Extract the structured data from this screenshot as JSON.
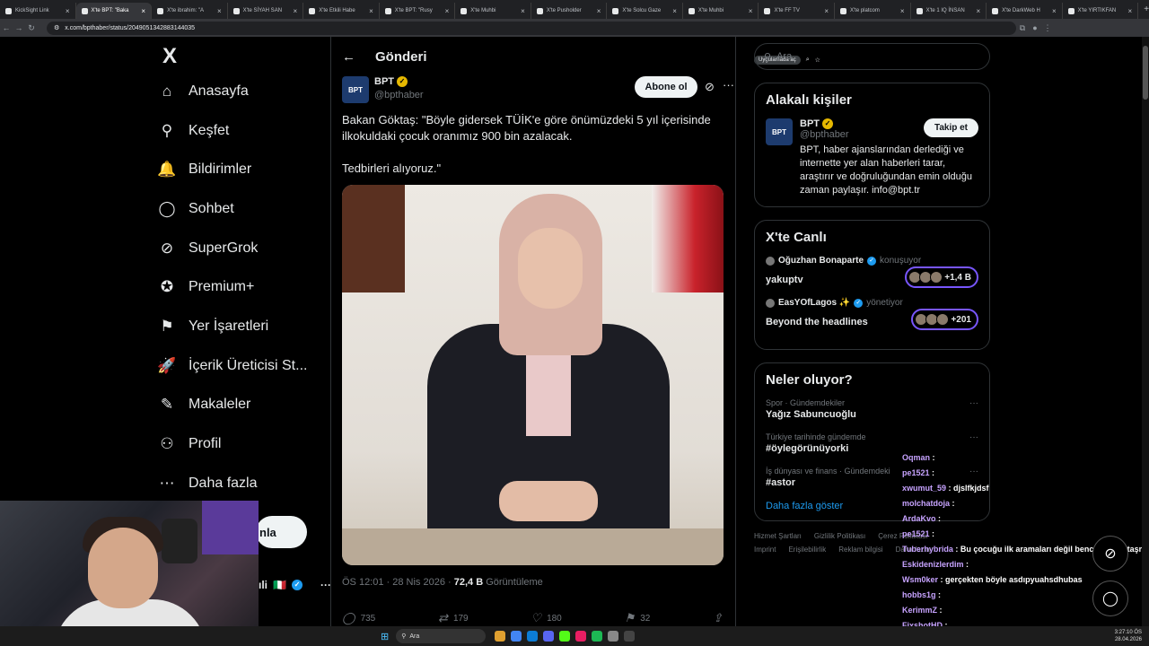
{
  "browser": {
    "tabs": [
      {
        "label": "KickSight Link"
      },
      {
        "label": "X'te BPT: \"Baka",
        "active": true
      },
      {
        "label": "X'te ibrahim: \"A"
      },
      {
        "label": "X'te SİYAH SAN"
      },
      {
        "label": "X'te Etkili Habe"
      },
      {
        "label": "X'te BPT: \"Rusy"
      },
      {
        "label": "X'te Muhbi"
      },
      {
        "label": "X'te Pusholder"
      },
      {
        "label": "X'te Solcu Gaze"
      },
      {
        "label": "X'te Muhbi"
      },
      {
        "label": "X'te FF TV"
      },
      {
        "label": "X'te platcom"
      },
      {
        "label": "X'te 1 IQ İNSAN"
      },
      {
        "label": "X'te DarkWeb H"
      },
      {
        "label": "X'te YIRTIKFAN"
      }
    ],
    "url": "x.com/bpthaber/status/2049051342883144035",
    "open_in_app": "Uygulamada aç"
  },
  "nav": {
    "logo": "X",
    "items": [
      {
        "label": "Anasayfa",
        "icon": "home-icon",
        "glyph": "⌂"
      },
      {
        "label": "Keşfet",
        "icon": "search-icon",
        "glyph": "⚲"
      },
      {
        "label": "Bildirimler",
        "icon": "bell-icon",
        "glyph": "🔔"
      },
      {
        "label": "Sohbet",
        "icon": "chat-icon",
        "glyph": "◯"
      },
      {
        "label": "SuperGrok",
        "icon": "grok-icon",
        "glyph": "⊘"
      },
      {
        "label": "Premium+",
        "icon": "premium-icon",
        "glyph": "✪"
      },
      {
        "label": "Yer İşaretleri",
        "icon": "bookmark-icon",
        "glyph": "⚑"
      },
      {
        "label": "İçerik Üreticisi St...",
        "icon": "rocket-icon",
        "glyph": "🚀"
      },
      {
        "label": "Makaleler",
        "icon": "article-icon",
        "glyph": "✎"
      },
      {
        "label": "Profil",
        "icon": "profile-icon",
        "glyph": "⚇"
      },
      {
        "label": "Daha fazla",
        "icon": "more-icon",
        "glyph": "⋯"
      }
    ],
    "post_button": "nla",
    "account_name": "ıli"
  },
  "post": {
    "header": "Gönderi",
    "author_name": "BPT",
    "author_handle": "@bpthaber",
    "avatar_text": "BPT",
    "subscribe": "Abone ol",
    "text_line1": "Bakan Göktaş: \"Böyle gidersek TÜİK'e göre önümüzdeki 5 yıl içerisinde ilkokuldaki çocuk oranımız 900 bin azalacak.",
    "text_line2": "Tedbirleri alıyoruz.\"",
    "time": "ÖS 12:01 · 28 Nis 2026 · ",
    "views": "72,4 B",
    "views_label": " Görüntüleme",
    "replies": "735",
    "reposts": "179",
    "likes": "180",
    "bookmarks": "32"
  },
  "sidebar": {
    "search_placeholder": "Ara",
    "related_title": "Alakalı kişiler",
    "related": {
      "name": "BPT",
      "handle": "@bpthaber",
      "follow": "Takip et",
      "bio": "BPT, haber ajanslarından derlediği ve internette yer alan haberleri tarar, araştırır ve doğruluğundan emin olduğu zaman paylaşır. info@bpt.tr"
    },
    "live_title": "X'te Canlı",
    "live": [
      {
        "host": "Oğuzhan Bonaparte",
        "role": "konuşuyor",
        "title": "yakuptv",
        "count": "+1,4 B"
      },
      {
        "host": "EasYOfLagos ✨",
        "role": "yönetiyor",
        "title": "Beyond the headlines",
        "count": "+201"
      }
    ],
    "trends_title": "Neler oluyor?",
    "trends": [
      {
        "category": "Spor · Gündemdekiler",
        "title": "Yağız Sabuncuoğlu"
      },
      {
        "category": "Türkiye tarihinde gündemde",
        "title": "#öylegörünüyorki"
      },
      {
        "category": "İş dünyası ve finans · Gündemdeki",
        "title": "#astor"
      }
    ],
    "show_more": "Daha fazla göster",
    "footer": [
      "Hizmet Şartları",
      "Gizlilik Politikası",
      "Çerez Politikası",
      "Imprint",
      "Erişilebilirlik",
      "Reklam bilgisi",
      "Daha fazla"
    ]
  },
  "chat": [
    {
      "user": "Oqman",
      "msg": ""
    },
    {
      "user": "pe1521",
      "msg": ""
    },
    {
      "user": "xwumut_59",
      "msg": "djslfkjdsf"
    },
    {
      "user": "molchatdoja",
      "msg": ""
    },
    {
      "user": "ArdaKvo",
      "msg": ""
    },
    {
      "user": "pe1521",
      "msg": ""
    },
    {
      "user": "Tuberhybrida",
      "msg": "Bu çocuğu ilk aramaları değil bence. Adam taşmış."
    },
    {
      "user": "Eskidenizlerdim",
      "msg": ""
    },
    {
      "user": "Wsm0ker",
      "msg": "gerçekten böyle asdıpyuahsdhubas"
    },
    {
      "user": "hobbs1g",
      "msg": ""
    },
    {
      "user": "KerimmZ",
      "msg": ""
    },
    {
      "user": "FixshotHD",
      "msg": ""
    }
  ],
  "taskbar": {
    "search": "Ara",
    "time": "3:27:10 ÖS",
    "date": "28.04.2026"
  },
  "colors": {
    "accent": "#1d9bf0",
    "live_ring": "#7856ff",
    "chat_user": "#c7a3ff"
  }
}
